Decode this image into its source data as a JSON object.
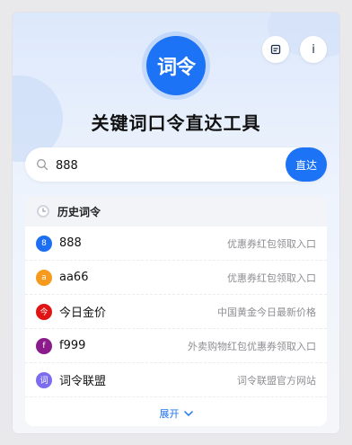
{
  "app": {
    "logo_text": "词令",
    "title": "关键词口令直达工具"
  },
  "top_icons": [
    {
      "icon": "bookmark-icon"
    },
    {
      "icon": "info-icon",
      "glyph": "i"
    }
  ],
  "search": {
    "value": "888",
    "button_label": "直达"
  },
  "history": {
    "heading": "历史词令",
    "items": [
      {
        "badge": "8",
        "badge_color": "#1c6ef2",
        "keyword": "888",
        "description": "优惠券红包领取入口"
      },
      {
        "badge": "a",
        "badge_color": "#f59a1c",
        "keyword": "aa66",
        "description": "优惠券红包领取入口"
      },
      {
        "badge": "今",
        "badge_color": "#e01414",
        "keyword": "今日金价",
        "description": "中国黄金今日最新价格"
      },
      {
        "badge": "f",
        "badge_color": "#8b1a8a",
        "keyword": "f999",
        "description": "外卖购物红包优惠券领取入口"
      },
      {
        "badge": "词",
        "badge_color": "#7b6cf0",
        "keyword": "词令联盟",
        "description": "词令联盟官方网站"
      }
    ],
    "expand_label": "展开"
  }
}
